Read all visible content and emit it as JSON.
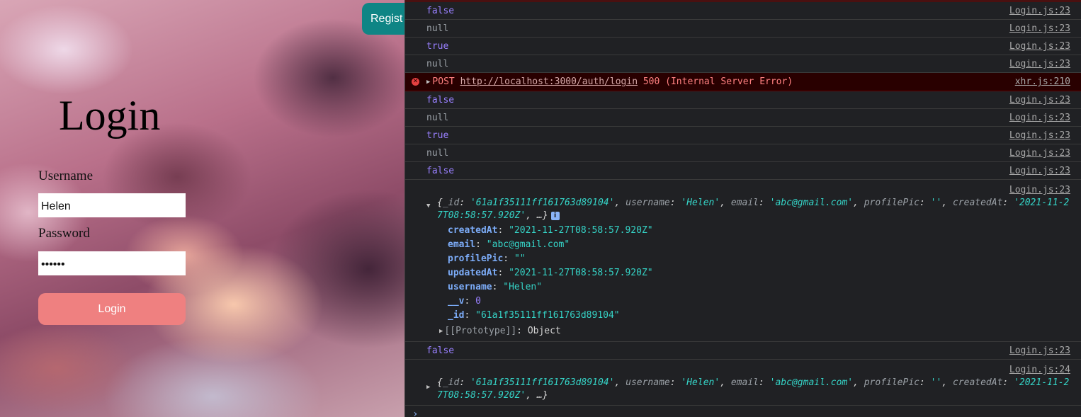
{
  "app": {
    "title": "Login",
    "register_label": "Regist",
    "username_label": "Username",
    "username_value": "Helen",
    "password_label": "Password",
    "password_value": "••••••",
    "login_button": "Login"
  },
  "console": {
    "rows_top": [
      {
        "value": "false",
        "source": "Login.js:23"
      },
      {
        "value": "null",
        "source": "Login.js:23"
      },
      {
        "value": "true",
        "source": "Login.js:23"
      },
      {
        "value": "null",
        "source": "Login.js:23"
      }
    ],
    "error": {
      "method": "POST",
      "url": "http://localhost:3000/auth/login",
      "status": "500 (Internal Server Error)",
      "source": "xhr.js:210"
    },
    "rows_mid": [
      {
        "value": "false",
        "source": "Login.js:23"
      },
      {
        "value": "null",
        "source": "Login.js:23"
      },
      {
        "value": "true",
        "source": "Login.js:23"
      },
      {
        "value": "null",
        "source": "Login.js:23"
      },
      {
        "value": "false",
        "source": "Login.js:23"
      }
    ],
    "object_expanded": {
      "source": "Login.js:23",
      "summary_parts": [
        {
          "t": "{",
          "c": "p"
        },
        {
          "t": "_id",
          "c": "k"
        },
        {
          "t": ": ",
          "c": "p"
        },
        {
          "t": "'61a1f35111ff161763d89104'",
          "c": "s"
        },
        {
          "t": ", ",
          "c": "p"
        },
        {
          "t": "username",
          "c": "k"
        },
        {
          "t": ": ",
          "c": "p"
        },
        {
          "t": "'Helen'",
          "c": "s"
        },
        {
          "t": ", ",
          "c": "p"
        },
        {
          "t": "email",
          "c": "k"
        },
        {
          "t": ": ",
          "c": "p"
        },
        {
          "t": "'abc@gmail.com'",
          "c": "s"
        },
        {
          "t": ", ",
          "c": "p"
        },
        {
          "t": "profilePic",
          "c": "k"
        },
        {
          "t": ": ",
          "c": "p"
        },
        {
          "t": "''",
          "c": "s"
        },
        {
          "t": ", ",
          "c": "p"
        },
        {
          "t": "createdAt",
          "c": "k"
        },
        {
          "t": ": ",
          "c": "p"
        },
        {
          "t": "'2021-11-27T08:58:57.920Z'",
          "c": "s"
        },
        {
          "t": ", …}",
          "c": "p"
        }
      ],
      "info_badge": "i",
      "props": [
        {
          "key": "createdAt",
          "value": "\"2021-11-27T08:58:57.920Z\"",
          "type": "s"
        },
        {
          "key": "email",
          "value": "\"abc@gmail.com\"",
          "type": "s"
        },
        {
          "key": "profilePic",
          "value": "\"\"",
          "type": "s"
        },
        {
          "key": "updatedAt",
          "value": "\"2021-11-27T08:58:57.920Z\"",
          "type": "s"
        },
        {
          "key": "username",
          "value": "\"Helen\"",
          "type": "s"
        },
        {
          "key": "__v",
          "value": "0",
          "type": "n"
        },
        {
          "key": "_id",
          "value": "\"61a1f35111ff161763d89104\"",
          "type": "s"
        }
      ],
      "prototype_key": "[[Prototype]]",
      "prototype_value": "Object"
    },
    "row_after": {
      "value": "false",
      "source": "Login.js:23"
    },
    "object_collapsed": {
      "source": "Login.js:24"
    },
    "prompt": "›"
  },
  "colors": {
    "console_bg": "#202124",
    "false_true": "#9980ff",
    "string": "#35d4c7",
    "error_bg": "#290000",
    "login_btn": "#ef8080",
    "register_btn": "#0f8585"
  }
}
